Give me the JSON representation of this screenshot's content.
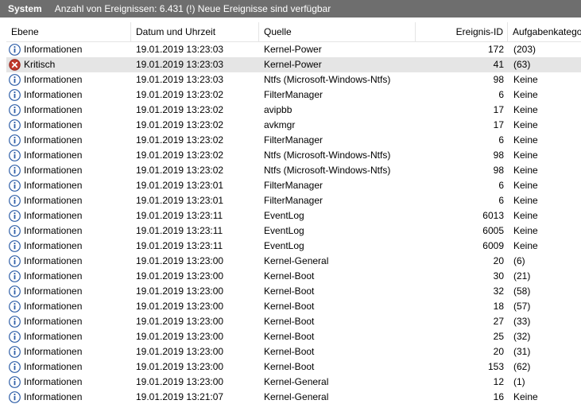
{
  "title": {
    "name": "System",
    "info": "Anzahl von Ereignissen: 6.431 (!) Neue Ereignisse sind verfügbar"
  },
  "columns": {
    "level": "Ebene",
    "date": "Datum und Uhrzeit",
    "source": "Quelle",
    "id": "Ereignis-ID",
    "category": "Aufgabenkategorie"
  },
  "icons": {
    "info": "info-icon",
    "critical": "critical-error-icon"
  },
  "colors": {
    "info_icon": "#2f5fa8",
    "critical_icon": "#c0392b",
    "selected_row": "#e5e5e5",
    "title_bar": "#6e6e6e"
  },
  "rows": [
    {
      "level": "Informationen",
      "type": "info",
      "date": "19.01.2019 13:23:03",
      "source": "Kernel-Power",
      "id": "172",
      "category": "(203)"
    },
    {
      "level": "Kritisch",
      "type": "critical",
      "date": "19.01.2019 13:23:03",
      "source": "Kernel-Power",
      "id": "41",
      "category": "(63)",
      "selected": true
    },
    {
      "level": "Informationen",
      "type": "info",
      "date": "19.01.2019 13:23:03",
      "source": "Ntfs (Microsoft-Windows-Ntfs)",
      "id": "98",
      "category": "Keine"
    },
    {
      "level": "Informationen",
      "type": "info",
      "date": "19.01.2019 13:23:02",
      "source": "FilterManager",
      "id": "6",
      "category": "Keine"
    },
    {
      "level": "Informationen",
      "type": "info",
      "date": "19.01.2019 13:23:02",
      "source": "avipbb",
      "id": "17",
      "category": "Keine"
    },
    {
      "level": "Informationen",
      "type": "info",
      "date": "19.01.2019 13:23:02",
      "source": "avkmgr",
      "id": "17",
      "category": "Keine"
    },
    {
      "level": "Informationen",
      "type": "info",
      "date": "19.01.2019 13:23:02",
      "source": "FilterManager",
      "id": "6",
      "category": "Keine"
    },
    {
      "level": "Informationen",
      "type": "info",
      "date": "19.01.2019 13:23:02",
      "source": "Ntfs (Microsoft-Windows-Ntfs)",
      "id": "98",
      "category": "Keine"
    },
    {
      "level": "Informationen",
      "type": "info",
      "date": "19.01.2019 13:23:02",
      "source": "Ntfs (Microsoft-Windows-Ntfs)",
      "id": "98",
      "category": "Keine"
    },
    {
      "level": "Informationen",
      "type": "info",
      "date": "19.01.2019 13:23:01",
      "source": "FilterManager",
      "id": "6",
      "category": "Keine"
    },
    {
      "level": "Informationen",
      "type": "info",
      "date": "19.01.2019 13:23:01",
      "source": "FilterManager",
      "id": "6",
      "category": "Keine"
    },
    {
      "level": "Informationen",
      "type": "info",
      "date": "19.01.2019 13:23:11",
      "source": "EventLog",
      "id": "6013",
      "category": "Keine"
    },
    {
      "level": "Informationen",
      "type": "info",
      "date": "19.01.2019 13:23:11",
      "source": "EventLog",
      "id": "6005",
      "category": "Keine"
    },
    {
      "level": "Informationen",
      "type": "info",
      "date": "19.01.2019 13:23:11",
      "source": "EventLog",
      "id": "6009",
      "category": "Keine"
    },
    {
      "level": "Informationen",
      "type": "info",
      "date": "19.01.2019 13:23:00",
      "source": "Kernel-General",
      "id": "20",
      "category": "(6)"
    },
    {
      "level": "Informationen",
      "type": "info",
      "date": "19.01.2019 13:23:00",
      "source": "Kernel-Boot",
      "id": "30",
      "category": "(21)"
    },
    {
      "level": "Informationen",
      "type": "info",
      "date": "19.01.2019 13:23:00",
      "source": "Kernel-Boot",
      "id": "32",
      "category": "(58)"
    },
    {
      "level": "Informationen",
      "type": "info",
      "date": "19.01.2019 13:23:00",
      "source": "Kernel-Boot",
      "id": "18",
      "category": "(57)"
    },
    {
      "level": "Informationen",
      "type": "info",
      "date": "19.01.2019 13:23:00",
      "source": "Kernel-Boot",
      "id": "27",
      "category": "(33)"
    },
    {
      "level": "Informationen",
      "type": "info",
      "date": "19.01.2019 13:23:00",
      "source": "Kernel-Boot",
      "id": "25",
      "category": "(32)"
    },
    {
      "level": "Informationen",
      "type": "info",
      "date": "19.01.2019 13:23:00",
      "source": "Kernel-Boot",
      "id": "20",
      "category": "(31)"
    },
    {
      "level": "Informationen",
      "type": "info",
      "date": "19.01.2019 13:23:00",
      "source": "Kernel-Boot",
      "id": "153",
      "category": "(62)"
    },
    {
      "level": "Informationen",
      "type": "info",
      "date": "19.01.2019 13:23:00",
      "source": "Kernel-General",
      "id": "12",
      "category": "(1)"
    },
    {
      "level": "Informationen",
      "type": "info",
      "date": "19.01.2019 13:21:07",
      "source": "Kernel-General",
      "id": "16",
      "category": "Keine"
    }
  ]
}
